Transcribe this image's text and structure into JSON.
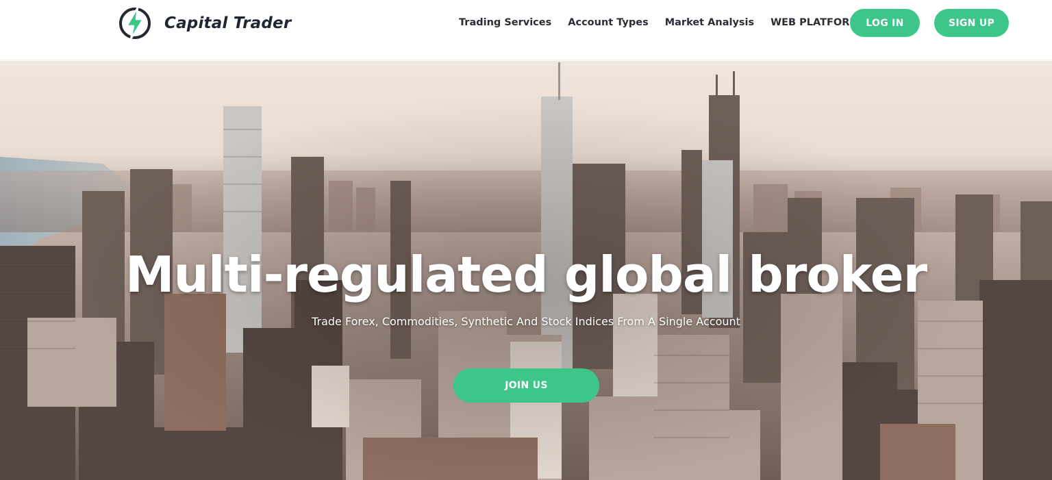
{
  "brand": {
    "name": "Capital Trader",
    "icon": "lightning-bolt-icon",
    "accent_color": "#3ec58a",
    "text_color": "#212533"
  },
  "nav": {
    "items": [
      {
        "label": "Trading Services"
      },
      {
        "label": "Account Types"
      },
      {
        "label": "Market Analysis"
      },
      {
        "label": "WEB PLATFORM"
      }
    ],
    "login_label": "LOG IN",
    "signup_label": "SIGN UP"
  },
  "hero": {
    "title": "Multi-regulated global broker",
    "subtitle": "Trade Forex, Commodities, Synthetic And Stock Indices From A Single Account",
    "cta_label": "JOIN US",
    "background": "city-skyline-photo"
  }
}
